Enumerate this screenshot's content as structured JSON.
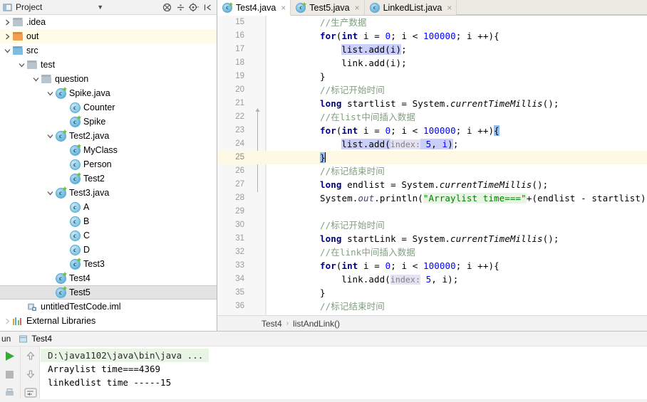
{
  "project_panel": {
    "title": "Project",
    "icon": "project-window-icon",
    "toolbar": [
      {
        "name": "collapse-all-icon",
        "label": ""
      },
      {
        "name": "expand-all-icon",
        "label": ""
      },
      {
        "name": "settings-gear-icon",
        "label": ""
      },
      {
        "name": "hide-panel-icon",
        "label": ""
      }
    ],
    "tree": [
      {
        "label": ".idea",
        "depth": 0,
        "twist": "collapsed",
        "icon": "folder-gray",
        "state": "normal"
      },
      {
        "label": "out",
        "depth": 0,
        "twist": "collapsed",
        "icon": "folder-orange",
        "state": "highlight"
      },
      {
        "label": "src",
        "depth": 0,
        "twist": "expanded",
        "icon": "folder-blue",
        "state": "normal"
      },
      {
        "label": "test",
        "depth": 1,
        "twist": "expanded",
        "icon": "folder-gray",
        "state": "normal"
      },
      {
        "label": "question",
        "depth": 2,
        "twist": "expanded",
        "icon": "folder-gray",
        "state": "normal"
      },
      {
        "label": "Spike.java",
        "depth": 3,
        "twist": "expanded",
        "icon": "java-class",
        "state": "normal"
      },
      {
        "label": "Counter",
        "depth": 4,
        "twist": "none",
        "icon": "java-class-plain",
        "state": "normal"
      },
      {
        "label": "Spike",
        "depth": 4,
        "twist": "none",
        "icon": "java-class",
        "state": "normal"
      },
      {
        "label": "Test2.java",
        "depth": 3,
        "twist": "expanded",
        "icon": "java-class",
        "state": "normal"
      },
      {
        "label": "MyClass",
        "depth": 4,
        "twist": "none",
        "icon": "java-class",
        "state": "normal"
      },
      {
        "label": "Person",
        "depth": 4,
        "twist": "none",
        "icon": "java-class-plain",
        "state": "normal"
      },
      {
        "label": "Test2",
        "depth": 4,
        "twist": "none",
        "icon": "java-class",
        "state": "normal"
      },
      {
        "label": "Test3.java",
        "depth": 3,
        "twist": "expanded",
        "icon": "java-class",
        "state": "normal"
      },
      {
        "label": "A",
        "depth": 4,
        "twist": "none",
        "icon": "java-class-plain",
        "state": "normal"
      },
      {
        "label": "B",
        "depth": 4,
        "twist": "none",
        "icon": "java-class-plain",
        "state": "normal"
      },
      {
        "label": "C",
        "depth": 4,
        "twist": "none",
        "icon": "java-class-plain",
        "state": "normal"
      },
      {
        "label": "D",
        "depth": 4,
        "twist": "none",
        "icon": "java-class-plain",
        "state": "normal"
      },
      {
        "label": "Test3",
        "depth": 4,
        "twist": "none",
        "icon": "java-class",
        "state": "normal"
      },
      {
        "label": "Test4",
        "depth": 3,
        "twist": "none",
        "icon": "java-class",
        "state": "normal"
      },
      {
        "label": "Test5",
        "depth": 3,
        "twist": "none",
        "icon": "java-class",
        "state": "selected"
      },
      {
        "label": "untitledTestCode.iml",
        "depth": 1,
        "twist": "none",
        "icon": "iml-module",
        "state": "normal"
      },
      {
        "label": "External Libraries",
        "depth": 0,
        "twist": "collapsed-faint",
        "icon": "library",
        "state": "normal"
      }
    ]
  },
  "editor": {
    "tabs": [
      {
        "label": "Test4.java",
        "active": true,
        "close": "×"
      },
      {
        "label": "Test5.java",
        "active": false,
        "close": "×"
      },
      {
        "label": "LinkedList.java",
        "active": false,
        "close": "×",
        "icon_variant": "library-class"
      }
    ],
    "breadcrumb": {
      "class_name": "Test4",
      "separator": "›",
      "method_name": "listAndLink()"
    },
    "first_visible_line": 15,
    "caret_line": 25,
    "lines": [
      {
        "n": 15,
        "indent": 8,
        "tokens": [
          {
            "t": "//生产数据",
            "c": "cmt"
          }
        ]
      },
      {
        "n": 16,
        "indent": 8,
        "tokens": [
          {
            "t": "for",
            "c": "kw"
          },
          {
            "t": "(",
            "c": "plain"
          },
          {
            "t": "int",
            "c": "kw"
          },
          {
            "t": " i = ",
            "c": "plain"
          },
          {
            "t": "0",
            "c": "num-lit"
          },
          {
            "t": "; i < ",
            "c": "plain"
          },
          {
            "t": "100000",
            "c": "num-lit"
          },
          {
            "t": "; i ++){",
            "c": "plain"
          }
        ]
      },
      {
        "n": 17,
        "indent": 12,
        "tokens": [
          {
            "t": "list.add(i)",
            "c": "sel"
          },
          {
            "t": ";",
            "c": "plain"
          }
        ]
      },
      {
        "n": 18,
        "indent": 12,
        "tokens": [
          {
            "t": "link.add(i);",
            "c": "plain"
          }
        ]
      },
      {
        "n": 19,
        "indent": 8,
        "tokens": [
          {
            "t": "}",
            "c": "plain"
          }
        ]
      },
      {
        "n": 20,
        "indent": 8,
        "tokens": [
          {
            "t": "//标记开始时间",
            "c": "cmt"
          }
        ]
      },
      {
        "n": 21,
        "indent": 8,
        "tokens": [
          {
            "t": "long",
            "c": "kw"
          },
          {
            "t": " startlist = System.",
            "c": "plain"
          },
          {
            "t": "currentTimeMillis",
            "c": "method-static"
          },
          {
            "t": "();",
            "c": "plain"
          }
        ]
      },
      {
        "n": 22,
        "indent": 8,
        "tokens": [
          {
            "t": "//在list中间插入数据",
            "c": "cmt"
          }
        ]
      },
      {
        "n": 23,
        "indent": 8,
        "tokens": [
          {
            "t": "for",
            "c": "kw"
          },
          {
            "t": "(",
            "c": "plain"
          },
          {
            "t": "int",
            "c": "kw"
          },
          {
            "t": " i = ",
            "c": "plain"
          },
          {
            "t": "0",
            "c": "num-lit"
          },
          {
            "t": "; i < ",
            "c": "plain"
          },
          {
            "t": "100000",
            "c": "num-lit"
          },
          {
            "t": "; i ++)",
            "c": "plain"
          },
          {
            "t": "{",
            "c": "bracehl"
          }
        ]
      },
      {
        "n": 24,
        "indent": 12,
        "tokens": [
          {
            "t": "list.add(",
            "c": "sel"
          },
          {
            "t": "index:",
            "c": "hint"
          },
          {
            "t": " ",
            "c": "sel"
          },
          {
            "t": "5",
            "c": "num-sel"
          },
          {
            "t": ", ",
            "c": "sel"
          },
          {
            "t": "i",
            "c": "num-sel"
          },
          {
            "t": ")",
            "c": "sel"
          },
          {
            "t": ";",
            "c": "plain"
          }
        ]
      },
      {
        "n": 25,
        "indent": 8,
        "tokens": [
          {
            "t": "}",
            "c": "bracehl"
          }
        ],
        "caret": true
      },
      {
        "n": 26,
        "indent": 8,
        "tokens": [
          {
            "t": "//标记结束时间",
            "c": "cmt"
          }
        ]
      },
      {
        "n": 27,
        "indent": 8,
        "tokens": [
          {
            "t": "long",
            "c": "kw"
          },
          {
            "t": " endlist = System.",
            "c": "plain"
          },
          {
            "t": "currentTimeMillis",
            "c": "method-static"
          },
          {
            "t": "();",
            "c": "plain"
          }
        ]
      },
      {
        "n": 28,
        "indent": 8,
        "tokens": [
          {
            "t": "System.",
            "c": "plain"
          },
          {
            "t": "out",
            "c": "field-static"
          },
          {
            "t": ".println(",
            "c": "plain"
          },
          {
            "t": "\"Arraylist time===\"",
            "c": "str"
          },
          {
            "t": "+(endlist - startlist));",
            "c": "plain"
          }
        ]
      },
      {
        "n": 29,
        "indent": 0,
        "tokens": []
      },
      {
        "n": 30,
        "indent": 8,
        "tokens": [
          {
            "t": "//标记开始时间",
            "c": "cmt"
          }
        ]
      },
      {
        "n": 31,
        "indent": 8,
        "tokens": [
          {
            "t": "long",
            "c": "kw"
          },
          {
            "t": " startLink = System.",
            "c": "plain"
          },
          {
            "t": "currentTimeMillis",
            "c": "method-static"
          },
          {
            "t": "();",
            "c": "plain"
          }
        ]
      },
      {
        "n": 32,
        "indent": 8,
        "tokens": [
          {
            "t": "//在link中间插入数据",
            "c": "cmt"
          }
        ]
      },
      {
        "n": 33,
        "indent": 8,
        "tokens": [
          {
            "t": "for",
            "c": "kw"
          },
          {
            "t": "(",
            "c": "plain"
          },
          {
            "t": "int",
            "c": "kw"
          },
          {
            "t": " i = ",
            "c": "plain"
          },
          {
            "t": "0",
            "c": "num-lit"
          },
          {
            "t": "; i < ",
            "c": "plain"
          },
          {
            "t": "100000",
            "c": "num-lit"
          },
          {
            "t": "; i ++){",
            "c": "plain"
          }
        ]
      },
      {
        "n": 34,
        "indent": 12,
        "tokens": [
          {
            "t": "link.add(",
            "c": "plain"
          },
          {
            "t": "index:",
            "c": "hint"
          },
          {
            "t": " ",
            "c": "plain"
          },
          {
            "t": "5",
            "c": "num-lit"
          },
          {
            "t": ", i);",
            "c": "plain"
          }
        ]
      },
      {
        "n": 35,
        "indent": 8,
        "tokens": [
          {
            "t": "}",
            "c": "plain"
          }
        ]
      },
      {
        "n": 36,
        "indent": 8,
        "tokens": [
          {
            "t": "//标记结束时间",
            "c": "cmt"
          }
        ]
      }
    ]
  },
  "run_panel": {
    "tool_label": "un",
    "config_name": "Test4",
    "side_buttons": [
      {
        "name": "rerun-run-icon"
      },
      {
        "name": "stop-icon"
      },
      {
        "name": "scroll-up-icon"
      },
      {
        "name": "scroll-down-icon"
      },
      {
        "name": "soft-wrap-icon"
      }
    ],
    "console_lines": [
      {
        "text": "D:\\java1102\\java\\bin\\java ...",
        "style": "command"
      },
      {
        "text": "Arraylist time===4369",
        "style": "output"
      },
      {
        "text": "linkedlist time -----15",
        "style": "output"
      }
    ]
  },
  "colors": {
    "panel_bg": "#f2f2f2",
    "editor_bg": "#ffffff",
    "tab_strip_bg": "#eceae3",
    "keyword": "#000080",
    "number": "#0000ff",
    "string": "#008000",
    "comment": "#80a080",
    "selection": "#c9cffa",
    "current_line": "#fdf9e4",
    "selected_row": "#e3e3e3",
    "highlight_row": "#fffbe6",
    "run_green": "#3aa93a"
  }
}
